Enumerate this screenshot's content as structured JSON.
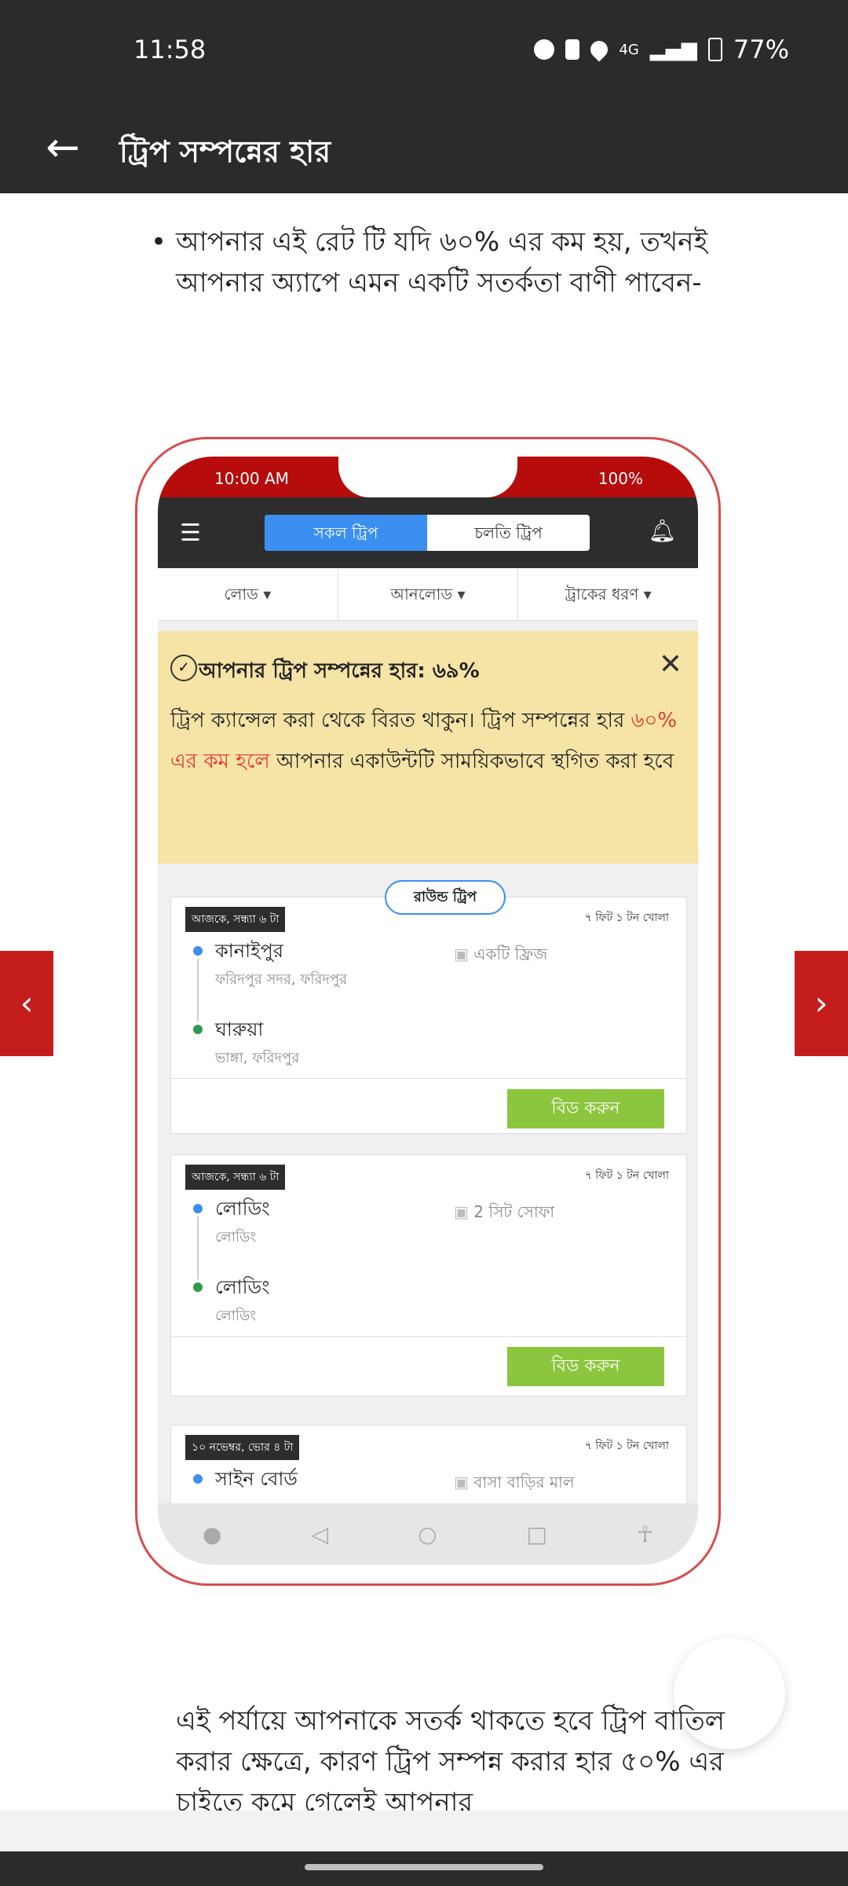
{
  "status_bar": {
    "time": "11:58",
    "battery": "77%",
    "network": "4G"
  },
  "app_bar": {
    "title": "ট্রিপ সম্পন্নের হার"
  },
  "content": {
    "bullet1": "আপনার এই রেট টি যদি ৬০% এর কম হয়, তখনই আপনার অ্যাপে এমন একটি সতর্কতা বাণী পাবেন-",
    "bullet2": "এই পর্যায়ে আপনাকে সতর্ক থাকতে হবে ট্রিপ বাতিল করার ক্ষেত্রে, কারণ ট্রিপ সম্পন্ন করার হার ৫০% এর চাইতে কমে গেলেই আপনার"
  },
  "phone": {
    "status_time": "10:00 AM",
    "status_battery": "100%",
    "tabs": [
      "সকল ট্রিপ",
      "চলতি ট্রিপ"
    ],
    "filters": [
      "লোড ▾",
      "আনলোড ▾",
      "ট্রাকের ধরণ ▾"
    ],
    "alert": {
      "title": "আপনার ট্রিপ সম্পন্নের হার: ৬৯%",
      "body_start": "ট্রিপ ক্যান্সেল করা থেকে বিরত থাকুন। ট্রিপ সম্পন্নের হার ",
      "body_red": "৬০% এর কম হলে",
      "body_end": " আপনার একাউন্টটি সাময়িকভাবে স্থগিত করা হবে"
    },
    "round_trip": "রাউন্ড ট্রিপ",
    "bid_label": "বিড করুন",
    "cards": [
      {
        "time": "আজকে, সন্ধ্যা ৬ টা",
        "truck": "৭ ফিট ১ টন খোলা",
        "from": "কানাইপুর",
        "from_sub": "ফরিদপুর সদর, ফরিদপুর",
        "to": "ঘারুয়া",
        "to_sub": "ভাঙ্গা, ফরিদপুর",
        "item": "একটি ফ্রিজ"
      },
      {
        "time": "আজকে, সন্ধ্যা ৬ টা",
        "truck": "৭ ফিট ১ টন খোলা",
        "from": "লোডিং",
        "from_sub": "লোডিং",
        "to": "লোডিং",
        "to_sub": "লোডিং",
        "item": "2 সিট সোফা"
      },
      {
        "time": "১০ নভেম্বর, ভোর ৪ টা",
        "truck": "৭ ফিট ১ টন খোলা",
        "from": "সাইন বোর্ড",
        "item": "বাসা বাড়ির মাল"
      }
    ]
  }
}
